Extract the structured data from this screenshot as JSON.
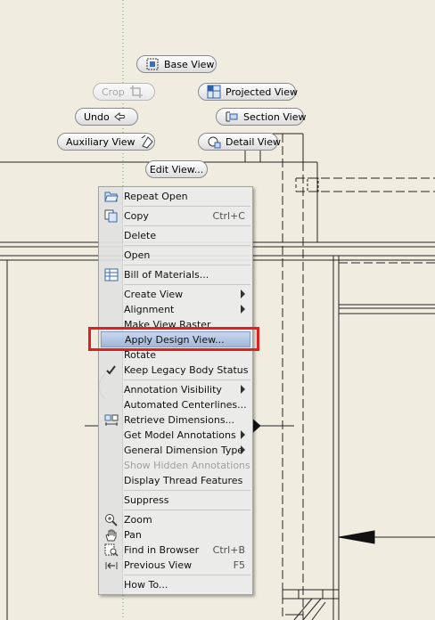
{
  "canvas": {
    "background": "#f0ede0",
    "line_color": "#222222",
    "highlight_color": "#e02020",
    "menu_highlight": "#9bb3d9"
  },
  "toolbar": {
    "base_view": {
      "label": "Base View",
      "icon": "base-view-icon",
      "enabled": true
    },
    "crop": {
      "label": "Crop",
      "icon": "crop-icon",
      "enabled": false
    },
    "projected_view": {
      "label": "Projected View",
      "icon": "projected-view-icon",
      "enabled": true
    },
    "undo": {
      "label": "Undo",
      "icon": "undo-icon",
      "enabled": true
    },
    "section_view": {
      "label": "Section View",
      "icon": "section-view-icon",
      "enabled": true
    },
    "auxiliary_view": {
      "label": "Auxiliary View",
      "icon": "auxiliary-view-icon",
      "enabled": true
    },
    "detail_view": {
      "label": "Detail View",
      "icon": "detail-view-icon",
      "enabled": true
    },
    "edit_view": {
      "label": "Edit View...",
      "icon": "",
      "enabled": true
    }
  },
  "menu": {
    "items": [
      {
        "label": "Repeat Open",
        "icon": "open-folder-icon"
      },
      {
        "label": "Copy",
        "shortcut": "Ctrl+C",
        "icon": "copy-icon"
      },
      {
        "label": "Delete"
      },
      {
        "label": "Open"
      },
      {
        "label": "Bill of Materials...",
        "icon": "bill-of-materials-icon"
      },
      {
        "label": "Create View",
        "submenu": true
      },
      {
        "label": "Alignment",
        "submenu": true
      },
      {
        "label": "Make View Raster"
      },
      {
        "label": "Apply Design View...",
        "highlighted": true
      },
      {
        "label": "Rotate"
      },
      {
        "label": "Keep Legacy Body Status",
        "checked": true,
        "icon": "checkmark-icon"
      },
      {
        "label": "Annotation Visibility",
        "submenu": true
      },
      {
        "label": "Automated Centerlines..."
      },
      {
        "label": "Retrieve Dimensions...",
        "icon": "retrieve-dimensions-icon"
      },
      {
        "label": "Get Model Annotations",
        "submenu": true
      },
      {
        "label": "General Dimension Type",
        "submenu": true
      },
      {
        "label": "Show Hidden Annotations",
        "disabled": true
      },
      {
        "label": "Display Thread Features"
      },
      {
        "label": "Suppress"
      },
      {
        "label": "Zoom",
        "icon": "zoom-icon"
      },
      {
        "label": "Pan",
        "icon": "pan-hand-icon"
      },
      {
        "label": "Find in Browser",
        "shortcut": "Ctrl+B",
        "icon": "find-in-browser-icon"
      },
      {
        "label": "Previous View",
        "shortcut": "F5",
        "icon": "previous-view-icon"
      },
      {
        "label": "How To..."
      }
    ]
  }
}
